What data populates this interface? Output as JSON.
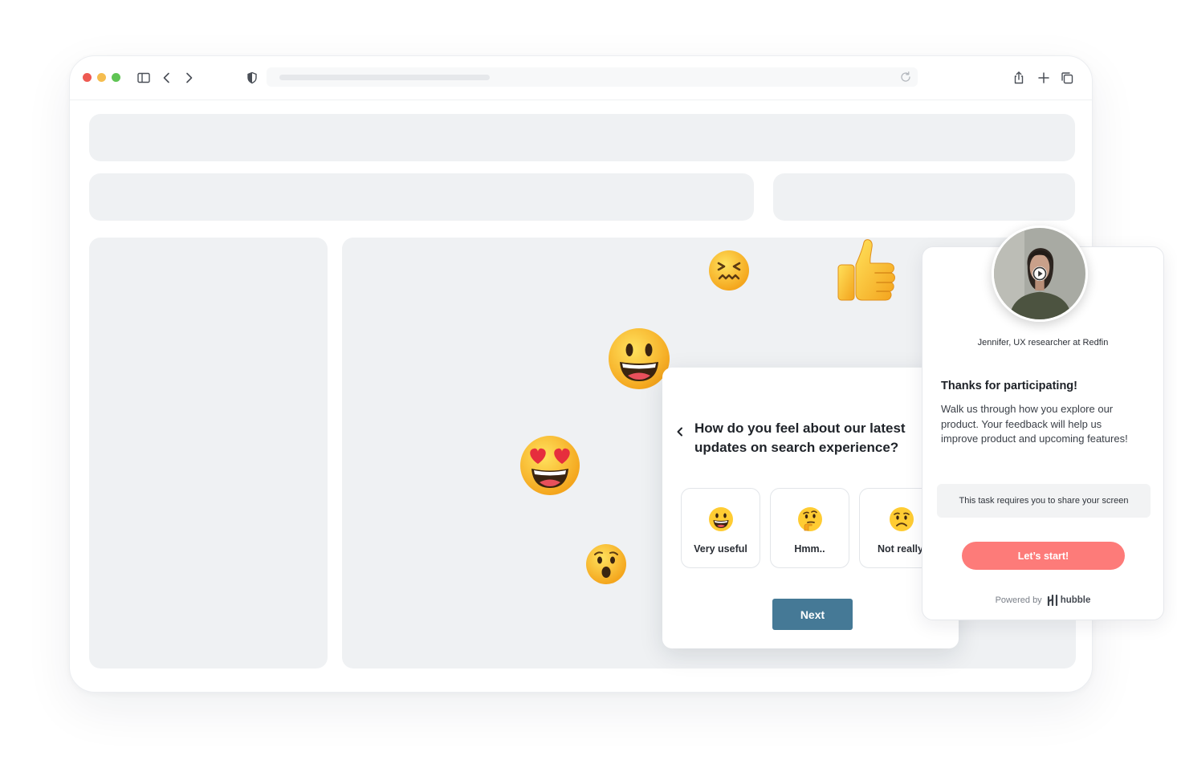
{
  "survey": {
    "question": "How do you feel about our latest updates on search experience?",
    "options": [
      {
        "label": "Very useful",
        "icon": "smiling-face-icon"
      },
      {
        "label": "Hmm..",
        "icon": "thinking-face-icon"
      },
      {
        "label": "Not really",
        "icon": "worried-face-icon"
      }
    ],
    "next_label": "Next"
  },
  "panel": {
    "researcher": "Jennifer, UX researcher at Redfin",
    "title": "Thanks for participating!",
    "body": "Walk us through how you explore our product. Your feedback will help us improve product and upcoming features!",
    "notice": "This task requires you to share your screen",
    "start_label": "Let’s start!",
    "powered_by": "Powered by",
    "brand": "hubble"
  },
  "colors": {
    "next_button": "#457996",
    "start_button": "#fd7b79",
    "placeholder": "#eff1f3"
  }
}
